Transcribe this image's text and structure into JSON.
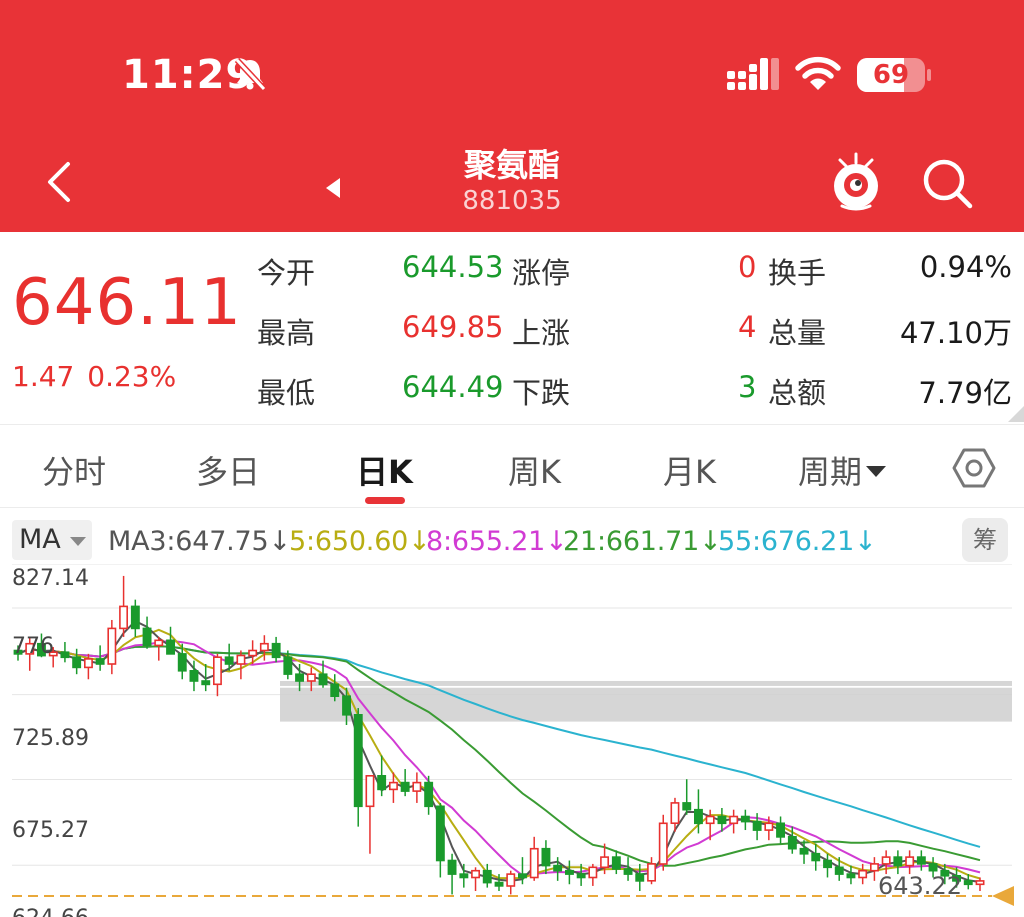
{
  "status_bar": {
    "time": "11:29",
    "battery": "69",
    "battery_level": 0.69
  },
  "header": {
    "title": "聚氨酯",
    "code": "881035"
  },
  "quote": {
    "price": "646.11",
    "change": "1.47",
    "change_pct": "0.23%",
    "open_label": "今开",
    "open": "644.53",
    "high_label": "最高",
    "high": "649.85",
    "low_label": "最低",
    "low": "644.49",
    "limit_up_label": "涨停",
    "limit_up": "0",
    "rise_label": "上涨",
    "rise": "4",
    "fall_label": "下跌",
    "fall": "3",
    "turnover_label": "换手",
    "turnover": "0.94%",
    "volume_label": "总量",
    "volume": "47.10万",
    "amount_label": "总额",
    "amount": "7.79亿"
  },
  "tabs": [
    {
      "label": "分时"
    },
    {
      "label": "多日"
    },
    {
      "label": "日K"
    },
    {
      "label": "周K"
    },
    {
      "label": "月K"
    },
    {
      "label": "周期"
    }
  ],
  "ma": {
    "selector": "MA",
    "items": [
      {
        "text": "MA3:647.75↓",
        "color": "#555555"
      },
      {
        "text": "5:650.60↓",
        "color": "#b8ad12"
      },
      {
        "text": "8:655.21↓",
        "color": "#d13bd3"
      },
      {
        "text": "21:661.71↓",
        "color": "#3a9b33"
      },
      {
        "text": "55:676.21↓",
        "color": "#2bb3cf"
      }
    ],
    "chip": "筹"
  },
  "chart_data": {
    "type": "candlestick",
    "y_axis_labels": [
      "827.14",
      "776",
      "725.89",
      "675.27",
      "624.66"
    ],
    "last_price_label": "643.22",
    "colors": {
      "up": "#e8312f",
      "down": "#1a9a2c",
      "ma3": "#555555",
      "ma5": "#b8ad12",
      "ma8": "#d13bd3",
      "ma21": "#3a9b33",
      "ma55": "#2bb3cf",
      "gap_zone": "#cfcfcf",
      "last_line": "#e9a83a"
    },
    "candles": [
      [
        782,
        785,
        776,
        780
      ],
      [
        780,
        790,
        770,
        786
      ],
      [
        786,
        792,
        778,
        779
      ],
      [
        779,
        784,
        772,
        781
      ],
      [
        781,
        787,
        775,
        778
      ],
      [
        778,
        783,
        768,
        772
      ],
      [
        772,
        780,
        765,
        777
      ],
      [
        777,
        785,
        770,
        774
      ],
      [
        774,
        800,
        768,
        795
      ],
      [
        795,
        826,
        790,
        808
      ],
      [
        808,
        812,
        790,
        795
      ],
      [
        795,
        802,
        783,
        785
      ],
      [
        785,
        790,
        776,
        788
      ],
      [
        788,
        796,
        782,
        780
      ],
      [
        780,
        786,
        765,
        770
      ],
      [
        770,
        776,
        758,
        764
      ],
      [
        764,
        774,
        758,
        762
      ],
      [
        762,
        780,
        755,
        778
      ],
      [
        778,
        786,
        770,
        774
      ],
      [
        774,
        782,
        765,
        779
      ],
      [
        779,
        788,
        774,
        782
      ],
      [
        782,
        791,
        776,
        786
      ],
      [
        786,
        790,
        775,
        778
      ],
      [
        778,
        782,
        765,
        768
      ],
      [
        768,
        774,
        758,
        764
      ],
      [
        764,
        772,
        758,
        768
      ],
      [
        768,
        776,
        760,
        762
      ],
      [
        762,
        768,
        752,
        755
      ],
      [
        755,
        760,
        738,
        744
      ],
      [
        744,
        748,
        678,
        690
      ],
      [
        690,
        708,
        662,
        708
      ],
      [
        708,
        720,
        696,
        700
      ],
      [
        700,
        710,
        692,
        704
      ],
      [
        704,
        712,
        696,
        699
      ],
      [
        699,
        710,
        692,
        704
      ],
      [
        704,
        708,
        685,
        690
      ],
      [
        690,
        692,
        648,
        658
      ],
      [
        658,
        662,
        638,
        650
      ],
      [
        650,
        656,
        642,
        648
      ],
      [
        648,
        654,
        640,
        652
      ],
      [
        652,
        656,
        642,
        645
      ],
      [
        645,
        650,
        640,
        643
      ],
      [
        643,
        652,
        638,
        650
      ],
      [
        650,
        660,
        644,
        648
      ],
      [
        648,
        672,
        646,
        665
      ],
      [
        665,
        670,
        650,
        655
      ],
      [
        655,
        660,
        646,
        652
      ],
      [
        652,
        658,
        644,
        650
      ],
      [
        650,
        656,
        643,
        648
      ],
      [
        648,
        656,
        643,
        654
      ],
      [
        654,
        668,
        650,
        660
      ],
      [
        660,
        664,
        650,
        653
      ],
      [
        653,
        660,
        646,
        650
      ],
      [
        650,
        656,
        640,
        646
      ],
      [
        646,
        660,
        644,
        656
      ],
      [
        656,
        685,
        652,
        680
      ],
      [
        680,
        695,
        675,
        692
      ],
      [
        692,
        706,
        685,
        688
      ],
      [
        688,
        700,
        674,
        680
      ],
      [
        680,
        688,
        670,
        684
      ],
      [
        684,
        689,
        675,
        680
      ],
      [
        680,
        688,
        674,
        684
      ],
      [
        684,
        688,
        676,
        681
      ],
      [
        681,
        686,
        670,
        676
      ],
      [
        676,
        684,
        670,
        680
      ],
      [
        680,
        684,
        668,
        672
      ],
      [
        672,
        678,
        662,
        665
      ],
      [
        665,
        670,
        656,
        662
      ],
      [
        662,
        668,
        652,
        658
      ],
      [
        658,
        662,
        648,
        654
      ],
      [
        654,
        660,
        646,
        650
      ],
      [
        650,
        655,
        644,
        648
      ],
      [
        648,
        656,
        644,
        652
      ],
      [
        652,
        660,
        646,
        656
      ],
      [
        656,
        664,
        650,
        660
      ],
      [
        660,
        664,
        650,
        655
      ],
      [
        655,
        664,
        650,
        660
      ],
      [
        660,
        664,
        652,
        656
      ],
      [
        656,
        660,
        648,
        652
      ],
      [
        652,
        656,
        644,
        649
      ],
      [
        649,
        654,
        642,
        646
      ],
      [
        646,
        650,
        641,
        644
      ],
      [
        644,
        648,
        640,
        646
      ]
    ]
  }
}
